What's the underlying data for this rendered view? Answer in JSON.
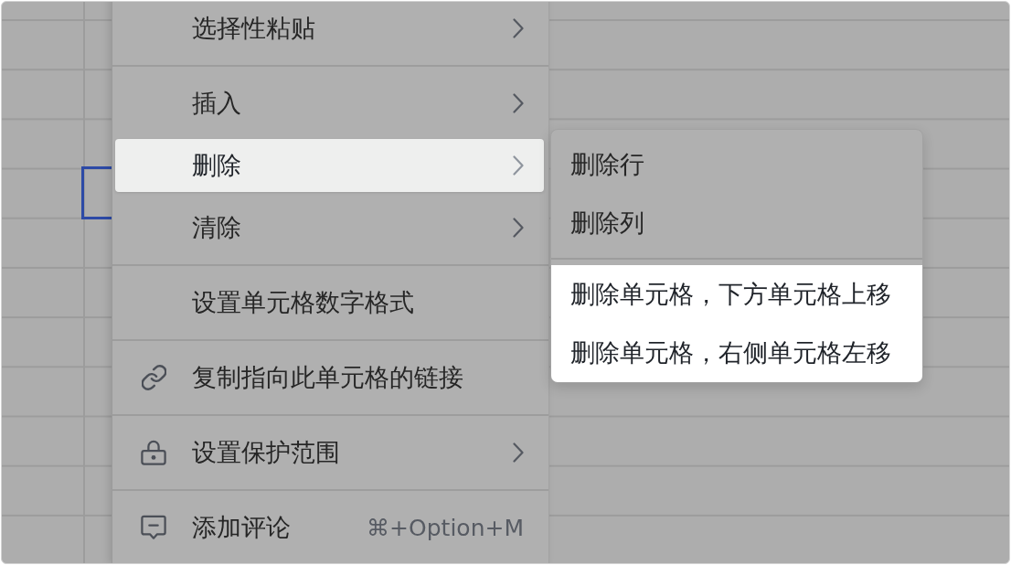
{
  "sheet": {
    "active_cell": true
  },
  "context_menu": {
    "groups": [
      {
        "items": [
          {
            "label": "选择性粘贴",
            "kind": "plain",
            "submenu": true,
            "highlighted": false
          }
        ]
      },
      {
        "items": [
          {
            "label": "插入",
            "kind": "plain",
            "submenu": true,
            "highlighted": false
          },
          {
            "label": "删除",
            "kind": "plain",
            "submenu": true,
            "highlighted": true
          },
          {
            "label": "清除",
            "kind": "plain",
            "submenu": true,
            "highlighted": false
          }
        ]
      },
      {
        "items": [
          {
            "label": "设置单元格数字格式",
            "kind": "plain",
            "submenu": false,
            "highlighted": false
          }
        ]
      },
      {
        "items": [
          {
            "label": "复制指向此单元格的链接",
            "kind": "copy_link",
            "submenu": false,
            "highlighted": false
          }
        ]
      },
      {
        "items": [
          {
            "label": "设置保护范围",
            "kind": "protect",
            "submenu": true,
            "highlighted": false
          }
        ]
      },
      {
        "items": [
          {
            "label": "添加评论",
            "kind": "comment",
            "submenu": false,
            "highlighted": false,
            "shortcut": "⌘+Option+M"
          }
        ]
      }
    ]
  },
  "submenu": {
    "groups": [
      {
        "items": [
          {
            "label": "删除行",
            "highlighted": false
          },
          {
            "label": "删除列",
            "highlighted": false
          }
        ]
      },
      {
        "items": [
          {
            "label": "删除单元格，下方单元格上移",
            "highlighted": true
          },
          {
            "label": "删除单元格，右侧单元格左移",
            "highlighted": true
          }
        ]
      }
    ]
  }
}
